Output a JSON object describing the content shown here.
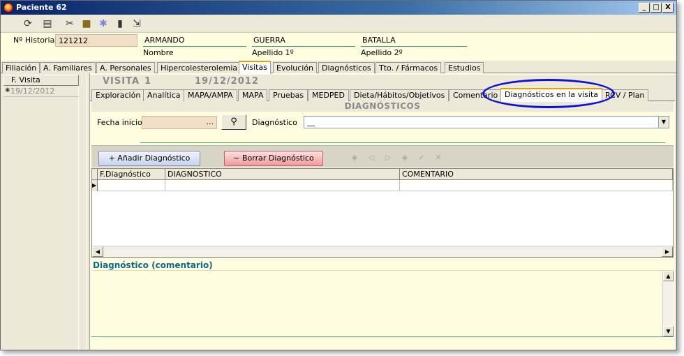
{
  "window": {
    "title": "Paciente 62",
    "minimize": "_",
    "restore": "□",
    "close": "X"
  },
  "toolbar": {
    "icons": [
      "refresh-icon",
      "print-icon",
      "tools-icon",
      "briefcase-icon",
      "puzzle-icon",
      "trash-icon",
      "exit-icon"
    ]
  },
  "patient": {
    "historia_label": "Nº Historia",
    "historia_value": "121212",
    "nombre_value": "ARMANDO",
    "nombre_label": "Nombre",
    "apellido1_value": "GUERRA",
    "apellido1_label": "Apellido 1º",
    "apellido2_value": "BATALLA",
    "apellido2_label": "Apellido 2º"
  },
  "main_tabs": [
    "Filiación",
    "A. Familiares",
    "A. Personales",
    "Hipercolesterolemia",
    "Visitas",
    "Evolución",
    "Diagnósticos",
    "Tto. / Fármacos",
    "Estudios"
  ],
  "main_tab_active": "Visitas",
  "visits": {
    "column_header": "F. Visita",
    "rows": [
      {
        "date": "19/12/2012"
      }
    ]
  },
  "visit_header": {
    "label": "VISITA",
    "number": "1",
    "date": "19/12/2012"
  },
  "sub_tabs": [
    "Exploración",
    "Analítica",
    "MAPA/AMPA",
    "MAPA",
    "Pruebas",
    "MEDPED",
    "Dieta/Hábitos/Objetivos",
    "Comentario",
    "Diagnósticos en la visita",
    "RCV / Plan"
  ],
  "sub_tab_active": "Diagnósticos en la visita",
  "section": {
    "title": "DIAGNÓSTICOS"
  },
  "filters": {
    "fecha_label": "Fecha inicio",
    "fecha_value": "...",
    "diag_label": "Diagnóstico",
    "diag_value": "__"
  },
  "actions": {
    "add_label": "+ Añadir Diagnóstico",
    "delete_label": "− Borrar Diagnóstico"
  },
  "grid": {
    "columns": [
      "F.Diagnóstico",
      "DIAGNOSTICO",
      "COMENTARIO"
    ]
  },
  "comment": {
    "title": "Diagnóstico (comentario)"
  }
}
